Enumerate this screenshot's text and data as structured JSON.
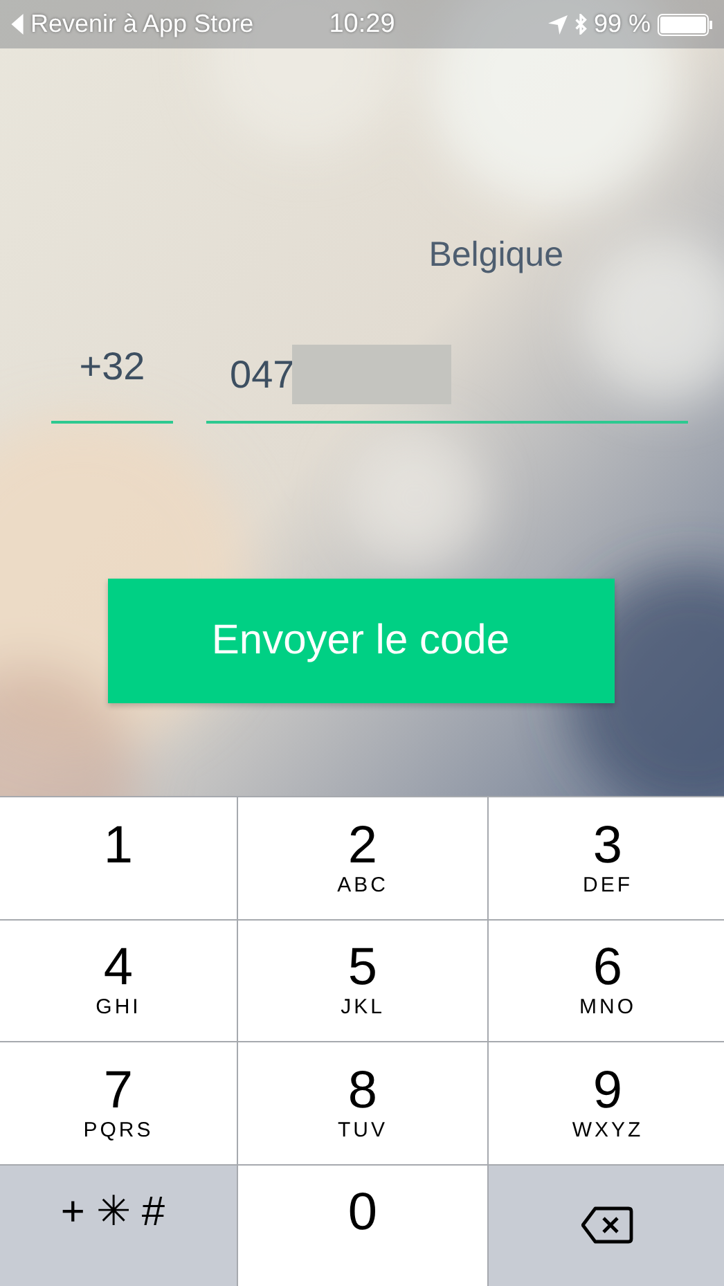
{
  "status_bar": {
    "back_label": "Revenir à App Store",
    "time": "10:29",
    "battery_text": "99 %"
  },
  "country": "Belgique",
  "phone": {
    "country_code": "+32",
    "number": "047"
  },
  "send_button": "Envoyer le code",
  "keypad": [
    {
      "kind": "digit",
      "digit": "1"
    },
    {
      "kind": "digit",
      "digit": "2",
      "letters": "ABC"
    },
    {
      "kind": "digit",
      "digit": "3",
      "letters": "DEF"
    },
    {
      "kind": "digit",
      "digit": "4",
      "letters": "GHI"
    },
    {
      "kind": "digit",
      "digit": "5",
      "letters": "JKL"
    },
    {
      "kind": "digit",
      "digit": "6",
      "letters": "MNO"
    },
    {
      "kind": "digit",
      "digit": "7",
      "letters": "PQRS"
    },
    {
      "kind": "digit",
      "digit": "8",
      "letters": "TUV"
    },
    {
      "kind": "digit",
      "digit": "9",
      "letters": "WXYZ"
    },
    {
      "kind": "symbols",
      "label": "+✳#"
    },
    {
      "kind": "digit",
      "digit": "0"
    },
    {
      "kind": "delete"
    }
  ]
}
